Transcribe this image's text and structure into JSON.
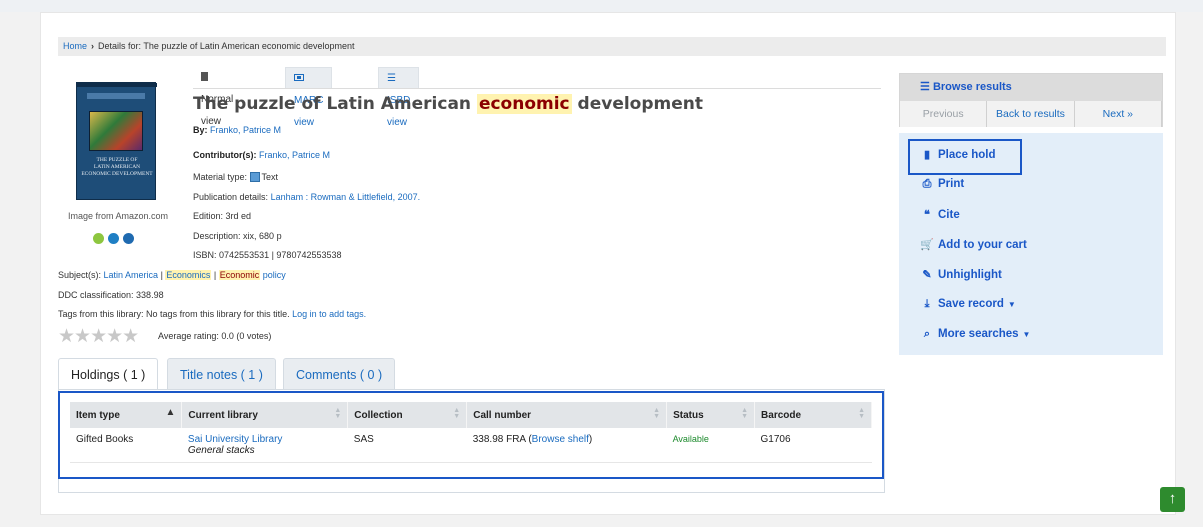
{
  "breadcrumb": {
    "home": "Home",
    "current": "Details for: The puzzle of Latin American economic development"
  },
  "view_tabs": [
    {
      "label": "Normal view",
      "icon": "document-icon",
      "active": true
    },
    {
      "label": "MARC view",
      "icon": "marc-icon",
      "active": false
    },
    {
      "label": "ISBD view",
      "icon": "list-icon",
      "active": false
    }
  ],
  "record": {
    "title_before": "The puzzle of Latin American ",
    "title_highlight": "economic",
    "title_after": " development",
    "by_label": "By:",
    "author": "Franko, Patrice M",
    "contributors_label": "Contributor(s):",
    "contributor": "Franko, Patrice M",
    "material_label": "Material type:",
    "material": "Text",
    "publication_label": "Publication details:",
    "publication": "Lanham : Rowman & Littlefield, 2007.",
    "edition_label": "Edition:",
    "edition": "3rd ed",
    "description_label": "Description:",
    "description": "xix, 680 p",
    "isbn_label": "ISBN:",
    "isbn": "0742553531 | 9780742553538",
    "subjects_label": "Subject(s):",
    "subject_1": "Latin America",
    "subject_2": "Economics",
    "subject_3_hl": "Economic",
    "subject_3_rest": " policy",
    "ddc_label": "DDC classification:",
    "ddc": "338.98",
    "tags_text": "Tags from this library:",
    "tags_none": "No tags from this library for this title.",
    "tags_login": "Log in to add tags.",
    "rating": "Average rating: 0.0 (0 votes)"
  },
  "cover": {
    "publisher": "Patrice Franko",
    "title_text": "THE PUZZLE OF LATIN AMERICAN ECONOMIC DEVELOPMENT",
    "source": "Image from Amazon.com",
    "dot_colors": [
      "#8dc63f",
      "#1f7fc4",
      "#1f6ab0"
    ]
  },
  "holdings_tabs": [
    {
      "label": "Holdings ( 1 )",
      "active": true
    },
    {
      "label": "Title notes ( 1 )",
      "active": false
    },
    {
      "label": "Comments ( 0 )",
      "active": false
    }
  ],
  "holdings": {
    "columns": [
      "Item type",
      "Current library",
      "Collection",
      "Call number",
      "Status",
      "Barcode"
    ],
    "rows": [
      {
        "item_type": "Gifted Books",
        "library": "Sai University Library",
        "location": "General stacks",
        "collection": "SAS",
        "call_number": "338.98 FRA",
        "browse": "Browse shelf",
        "status": "Available",
        "barcode": "G1706"
      }
    ]
  },
  "browse_results": {
    "title": "Browse results",
    "previous": "Previous",
    "back": "Back to results",
    "next": "Next"
  },
  "actions": [
    {
      "label": "Place hold",
      "icon": "bookmark-icon"
    },
    {
      "label": "Print",
      "icon": "printer-icon"
    },
    {
      "label": "Cite",
      "icon": "quote-icon"
    },
    {
      "label": "Add to your cart",
      "icon": "cart-icon"
    },
    {
      "label": "Unhighlight",
      "icon": "pencil-icon"
    },
    {
      "label": "Save record",
      "icon": "download-icon"
    },
    {
      "label": "More searches",
      "icon": "search-icon"
    }
  ],
  "colors": {
    "link": "#1a6bbf",
    "accent_border": "#1a57c7",
    "highlight": "#fff3b0",
    "available": "#1c8a2c"
  }
}
